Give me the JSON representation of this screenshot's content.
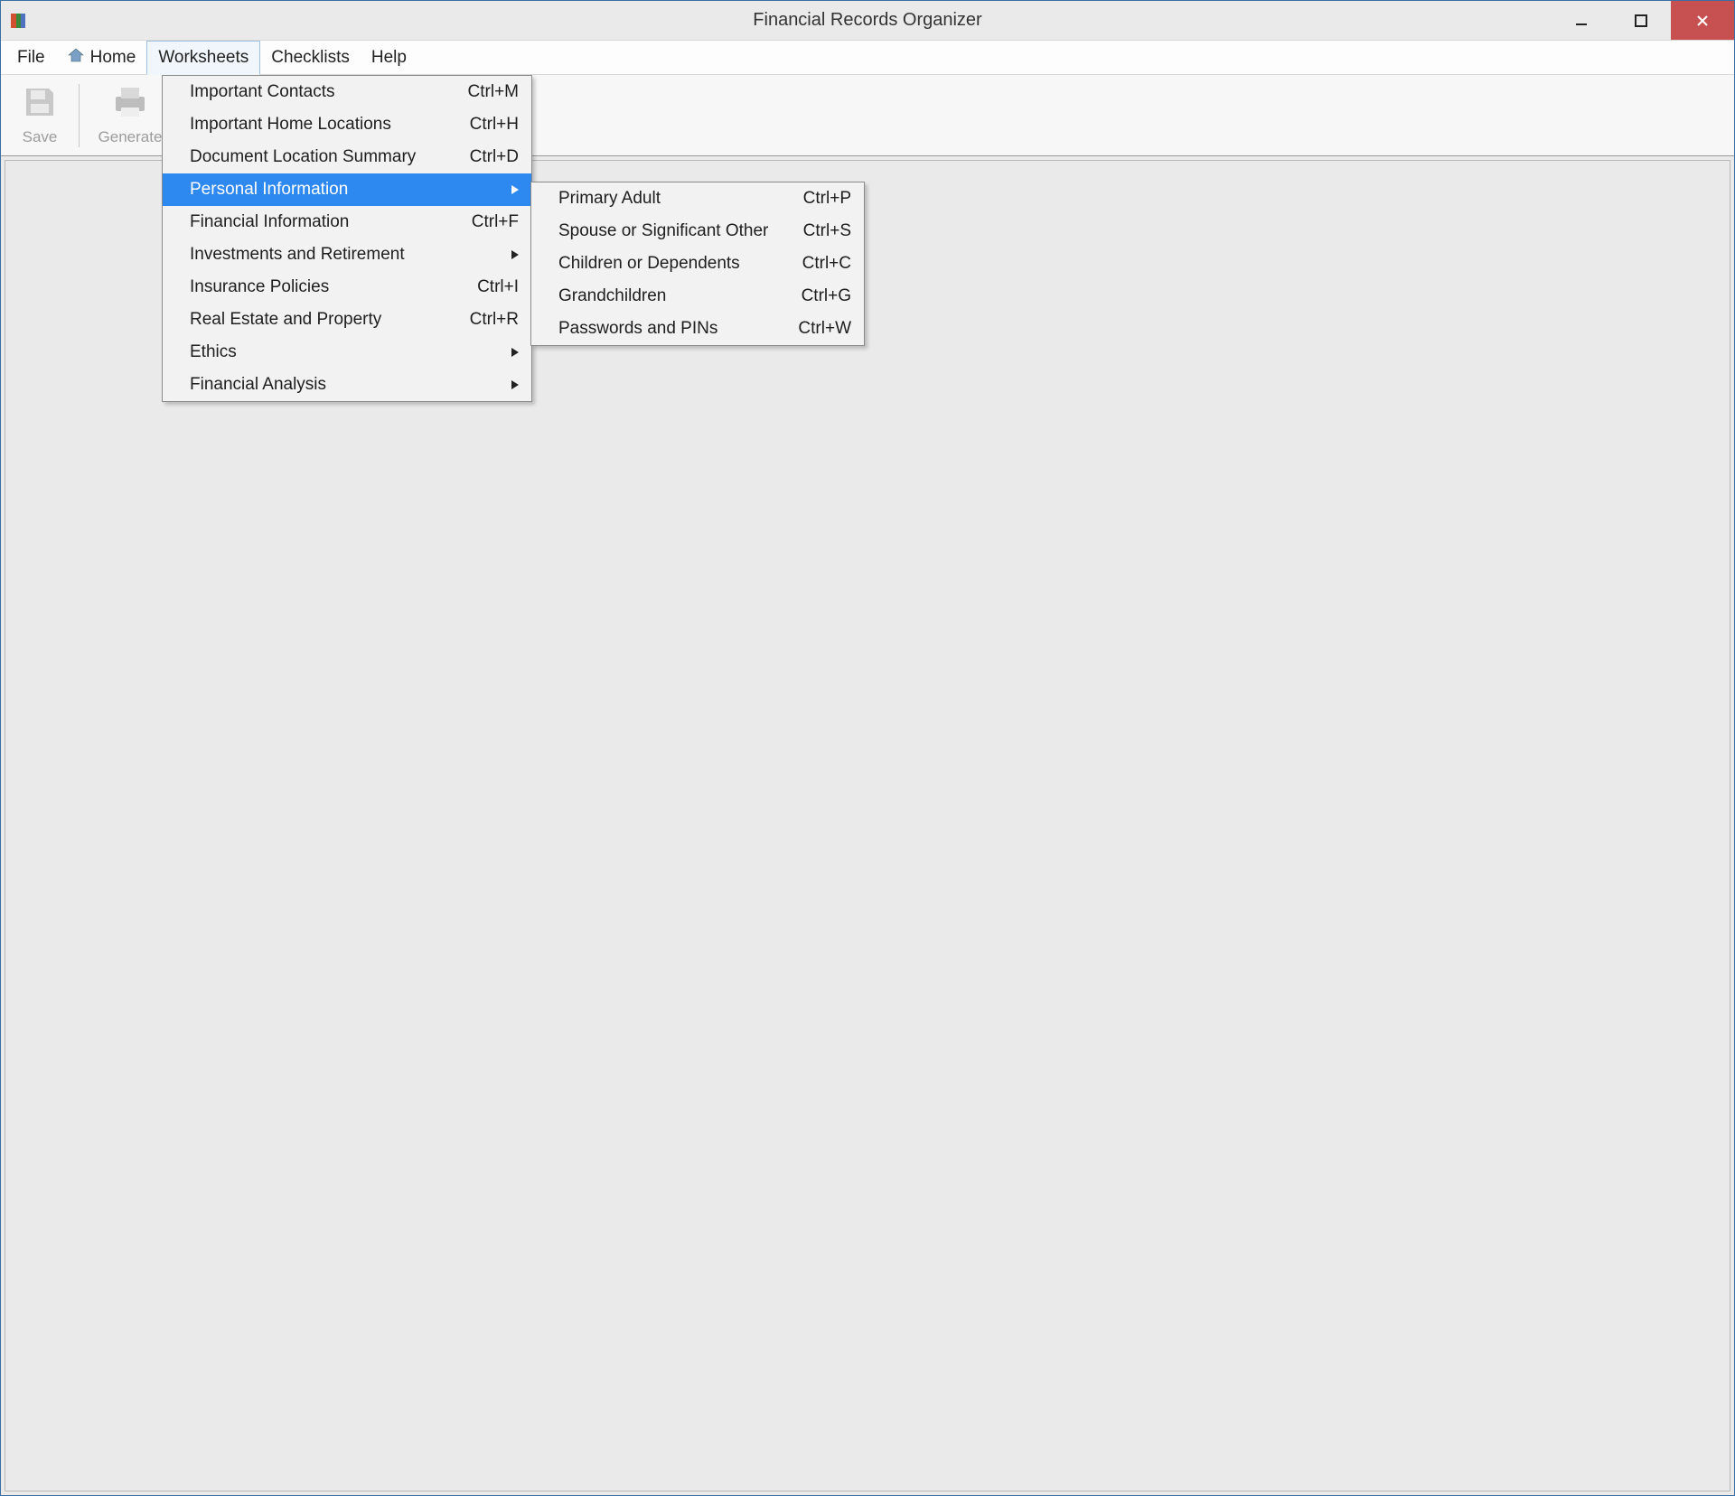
{
  "window": {
    "title": "Financial Records Organizer"
  },
  "menu_bar": {
    "file": "File",
    "home": "Home",
    "worksheets": "Worksheets",
    "checklists": "Checklists",
    "help": "Help"
  },
  "toolbar": {
    "save": "Save",
    "generate": "Generate"
  },
  "worksheets_menu": {
    "items": [
      {
        "label": "Important Contacts",
        "shortcut": "Ctrl+M",
        "submenu": false
      },
      {
        "label": "Important Home Locations",
        "shortcut": "Ctrl+H",
        "submenu": false
      },
      {
        "label": "Document Location Summary",
        "shortcut": "Ctrl+D",
        "submenu": false
      },
      {
        "label": "Personal Information",
        "shortcut": "",
        "submenu": true
      },
      {
        "label": "Financial Information",
        "shortcut": "Ctrl+F",
        "submenu": false
      },
      {
        "label": "Investments and Retirement",
        "shortcut": "",
        "submenu": true
      },
      {
        "label": "Insurance Policies",
        "shortcut": "Ctrl+I",
        "submenu": false
      },
      {
        "label": "Real Estate and Property",
        "shortcut": "Ctrl+R",
        "submenu": false
      },
      {
        "label": "Ethics",
        "shortcut": "",
        "submenu": true
      },
      {
        "label": "Financial Analysis",
        "shortcut": "",
        "submenu": true
      }
    ]
  },
  "personal_info_submenu": {
    "items": [
      {
        "label": "Primary Adult",
        "shortcut": "Ctrl+P"
      },
      {
        "label": "Spouse or Significant Other",
        "shortcut": "Ctrl+S"
      },
      {
        "label": "Children or Dependents",
        "shortcut": "Ctrl+C"
      },
      {
        "label": "Grandchildren",
        "shortcut": "Ctrl+G"
      },
      {
        "label": "Passwords and PINs",
        "shortcut": "Ctrl+W"
      }
    ]
  }
}
